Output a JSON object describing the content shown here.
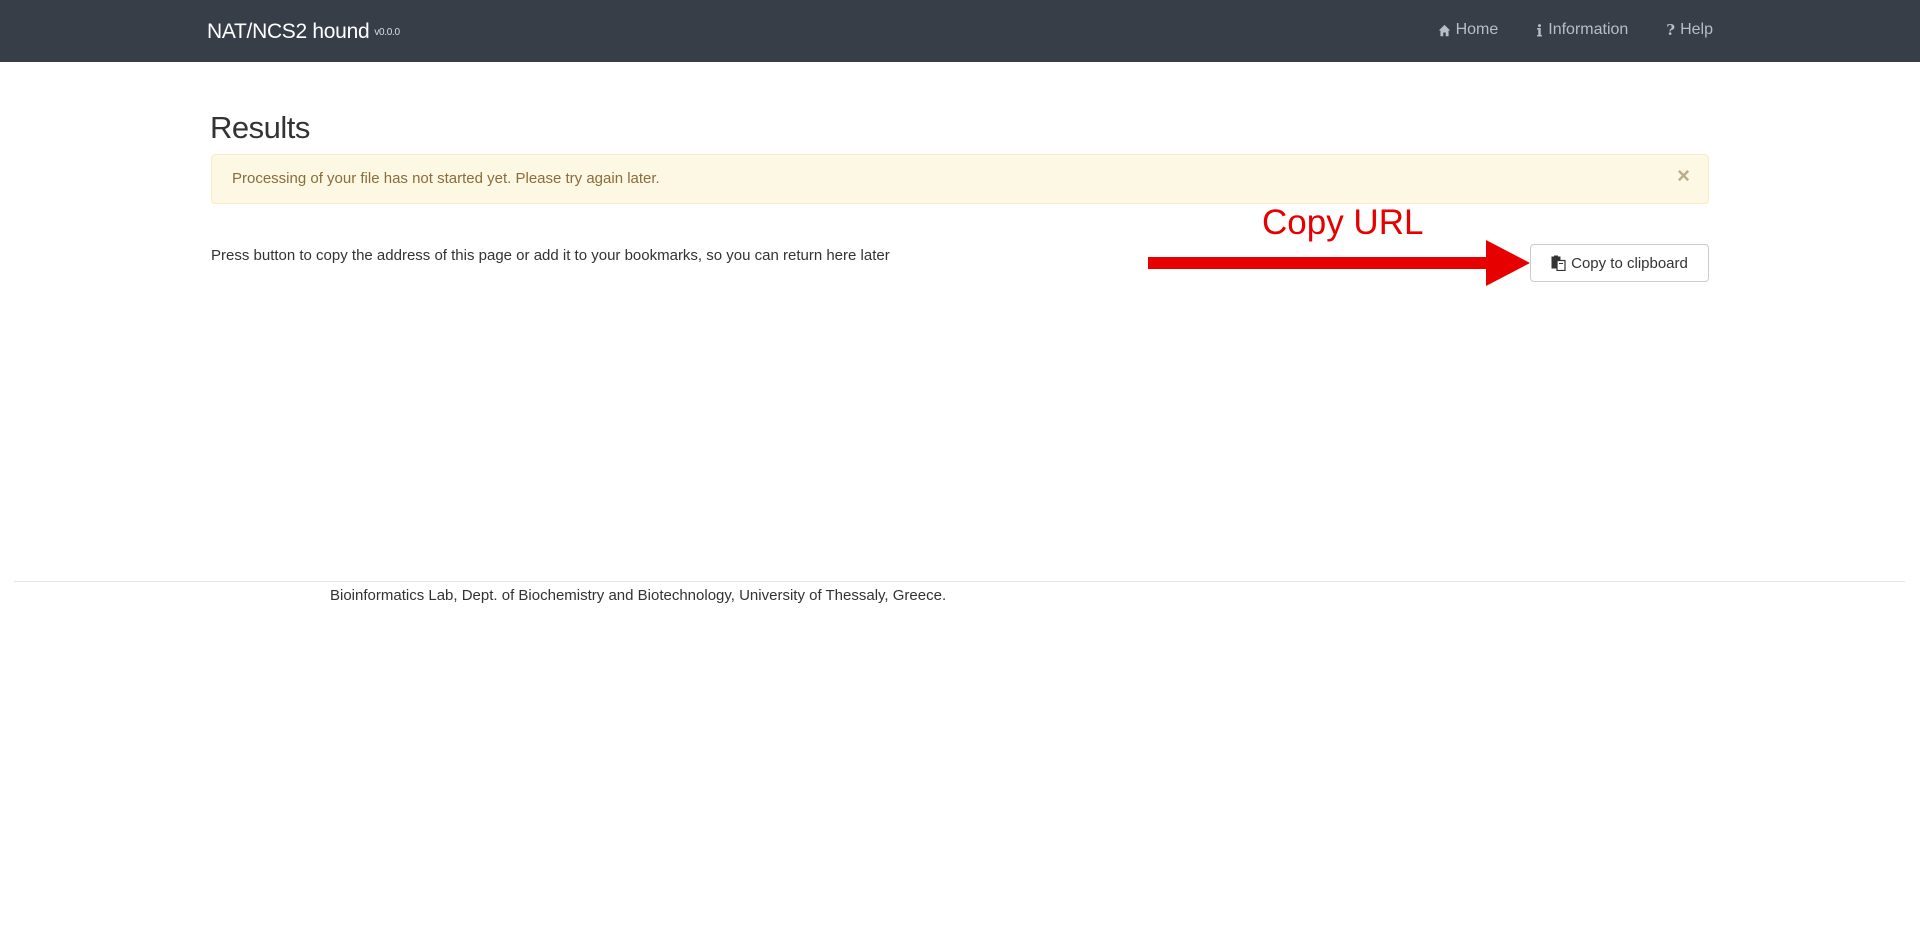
{
  "navbar": {
    "brand": "NAT/NCS2 hound",
    "version": "v0.0.0",
    "links": [
      {
        "label": "Home",
        "icon": "home-icon"
      },
      {
        "label": "Information",
        "icon": "info-icon"
      },
      {
        "label": "Help",
        "icon": "question-icon"
      }
    ]
  },
  "main": {
    "title": "Results",
    "alert": {
      "message": "Processing of your file has not started yet. Please try again later.",
      "close_symbol": "×"
    },
    "instructions": "Press button to copy the address of this page or add it to your bookmarks, so you can return here later",
    "copy_button": {
      "label": "Copy to clipboard",
      "icon": "clipboard-icon"
    }
  },
  "annotation": {
    "label": "Copy URL",
    "color": "#e60000"
  },
  "footer": {
    "text": "Bioinformatics Lab, Dept. of Biochemistry and Biotechnology, University of Thessaly, Greece."
  },
  "colors": {
    "navbar_bg": "#373e47",
    "alert_bg": "#fcf8e3",
    "alert_border": "#faebcc",
    "alert_text": "#8a6d3b"
  }
}
